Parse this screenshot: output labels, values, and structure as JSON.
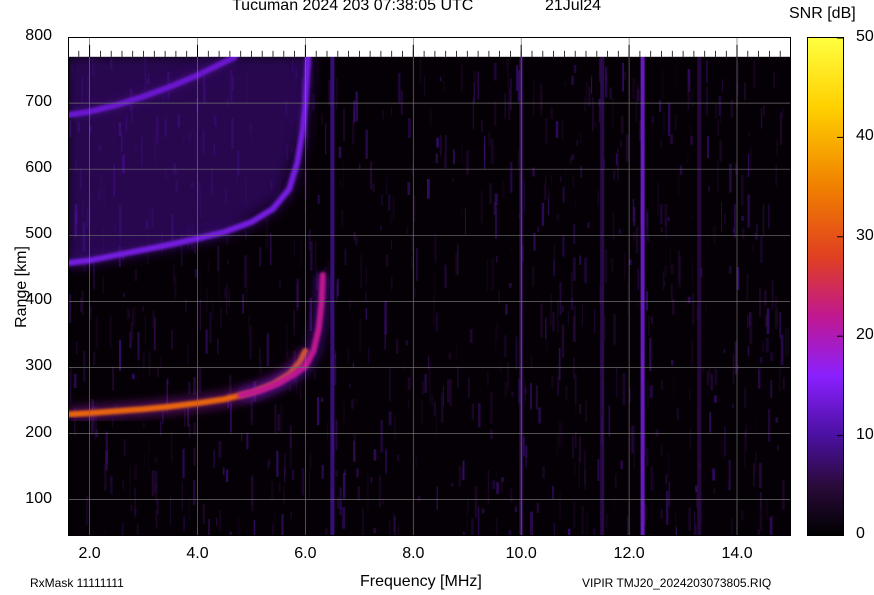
{
  "header": {
    "title": "Tucuman 2024 203 07:38:05 UTC",
    "date": "21Jul24"
  },
  "footer": {
    "rxmask": "RxMask 11111111",
    "source": "VIPIR  TMJ20_2024203073805.RIQ"
  },
  "chart_data": {
    "type": "heatmap",
    "title": "Tucuman 2024 203 07:38:05 UTC",
    "xlabel": "Frequency [MHz]",
    "ylabel": "Range [km]",
    "colorbar_label": "SNR [dB]",
    "xlim": [
      1.6,
      15.0
    ],
    "ylim": [
      45,
      800
    ],
    "data_ylim_top": 770,
    "xticks": [
      "2.0",
      "4.0",
      "6.0",
      "8.0",
      "10.0",
      "12.0",
      "14.0"
    ],
    "xtick_values": [
      2.0,
      4.0,
      6.0,
      8.0,
      10.0,
      12.0,
      14.0
    ],
    "yticks": [
      "100",
      "200",
      "300",
      "400",
      "500",
      "600",
      "700",
      "800"
    ],
    "ytick_values": [
      100,
      200,
      300,
      400,
      500,
      600,
      700,
      800
    ],
    "cbar_ticks": [
      "0",
      "10",
      "20",
      "30",
      "40",
      "50"
    ],
    "cbar_range": [
      0,
      50
    ],
    "colormap": [
      "#000000",
      "#2a0a3a",
      "#4a10a0",
      "#8a20ff",
      "#c01890",
      "#e04020",
      "#f08000",
      "#ffd000",
      "#ffff40"
    ],
    "grid": true,
    "traces": [
      {
        "name": "O-mode F trace",
        "snr": 32,
        "points": [
          [
            1.6,
            229
          ],
          [
            2.0,
            231
          ],
          [
            2.5,
            234
          ],
          [
            3.0,
            237
          ],
          [
            3.5,
            241
          ],
          [
            4.0,
            246
          ],
          [
            4.5,
            252
          ],
          [
            5.0,
            262
          ],
          [
            5.4,
            275
          ],
          [
            5.7,
            290
          ],
          [
            5.9,
            308
          ],
          [
            6.0,
            325
          ]
        ]
      },
      {
        "name": "X-mode F trace",
        "snr": 22,
        "points": [
          [
            4.8,
            258
          ],
          [
            5.2,
            266
          ],
          [
            5.5,
            276
          ],
          [
            5.8,
            290
          ],
          [
            6.0,
            302
          ],
          [
            6.15,
            325
          ],
          [
            6.25,
            360
          ],
          [
            6.3,
            400
          ],
          [
            6.32,
            440
          ]
        ]
      },
      {
        "name": "multi-hop trace",
        "snr": 14,
        "points": [
          [
            1.6,
            458
          ],
          [
            2.0,
            462
          ],
          [
            2.5,
            470
          ],
          [
            3.0,
            478
          ],
          [
            3.5,
            486
          ],
          [
            4.0,
            495
          ],
          [
            4.5,
            505
          ],
          [
            5.0,
            520
          ],
          [
            5.4,
            540
          ],
          [
            5.7,
            570
          ],
          [
            5.85,
            610
          ],
          [
            5.95,
            660
          ],
          [
            6.0,
            700
          ],
          [
            6.05,
            770
          ]
        ]
      },
      {
        "name": "upper echo",
        "snr": 13,
        "points": [
          [
            1.6,
            682
          ],
          [
            2.0,
            687
          ],
          [
            2.5,
            697
          ],
          [
            3.0,
            710
          ],
          [
            3.5,
            725
          ],
          [
            4.0,
            742
          ],
          [
            4.5,
            762
          ],
          [
            4.7,
            770
          ]
        ]
      }
    ],
    "interference_lines": [
      {
        "freq": 12.25,
        "snr": 16
      },
      {
        "freq": 6.5,
        "snr": 10
      },
      {
        "freq": 10.0,
        "snr": 7
      },
      {
        "freq": 11.5,
        "snr": 7
      },
      {
        "freq": 13.3,
        "snr": 6
      }
    ]
  }
}
